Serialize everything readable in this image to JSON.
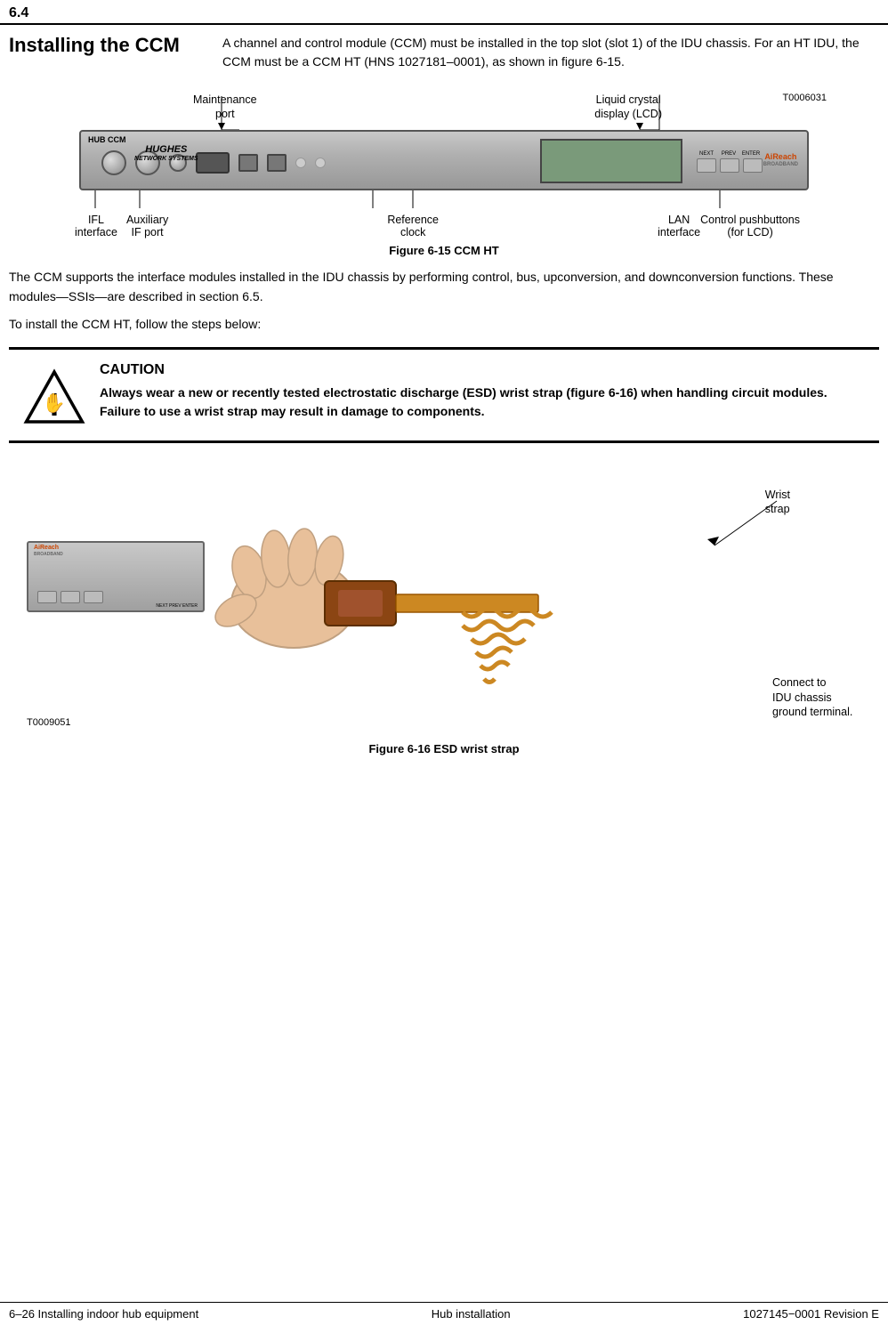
{
  "page": {
    "number": "6.4",
    "footer_left": "6–26  Installing indoor hub equipment",
    "footer_center": "Hub installation",
    "footer_right": "1027145−0001   Revision E"
  },
  "section": {
    "title": "Installing the CCM",
    "intro": "A channel and control module (CCM) must be installed in the top slot (slot 1) of the IDU chassis. For an HT IDU, the CCM must be a CCM HT (HNS 1027181–0001), as shown in figure 6-15."
  },
  "figure615": {
    "caption": "Figure  6-15    CCM HT",
    "t_ref": "T0006031",
    "hub_label": "HUB CCM",
    "labels": {
      "maintenance_port": "Maintenance\nport",
      "liquid_crystal": "Liquid crystal\ndisplay (LCD)",
      "ifl_interface": "IFL\ninterface",
      "auxiliary_if_port": "Auxiliary\nIF port",
      "reference_clock": "Reference\nclock",
      "lan_interface": "LAN\ninterface",
      "control_pushbuttons": "Control pushbuttons\n(for LCD)"
    },
    "button_labels": [
      "NEXT",
      "PREV",
      "ENTER"
    ]
  },
  "body_text1": "The CCM supports the interface modules installed in the IDU chassis by performing control, bus, upconversion, and downconversion functions. These modules—SSIs—are described in section 6.5.",
  "body_text2": "To install the CCM HT, follow the steps below:",
  "caution": {
    "title": "CAUTION",
    "body": "Always wear a new or recently tested electrostatic discharge (ESD) wrist strap (figure 6-16) when handling circuit modules. Failure to use a wrist strap may result in damage to components."
  },
  "figure616": {
    "caption": "Figure  6-16   ESD wrist strap",
    "t_ref": "T0009051",
    "wrist_strap_label": "Wrist\nstrap",
    "connect_label": "Connect to\nIDU chassis\nground terminal."
  }
}
